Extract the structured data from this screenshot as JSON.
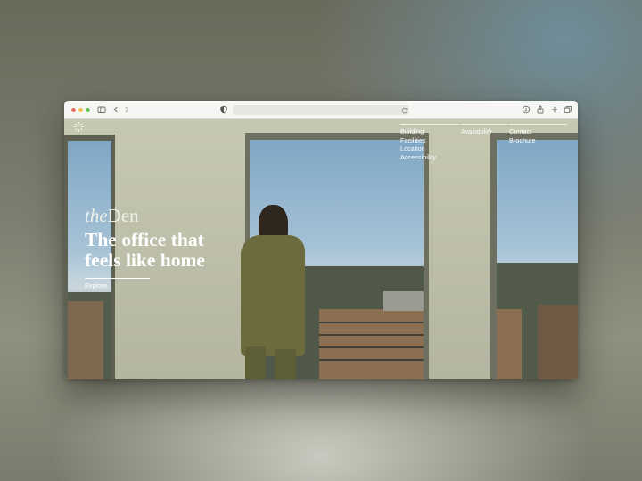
{
  "browser": {
    "buttons": {
      "close": "close",
      "minimize": "minimize",
      "zoom": "zoom"
    },
    "toolbar_icons": [
      "sidebar-icon",
      "chevron-left-icon",
      "chevron-right-icon",
      "shield-icon",
      "reload-icon",
      "download-icon",
      "share-icon",
      "plus-icon",
      "tabs-icon"
    ],
    "colors": {
      "close": "#ed6a5e",
      "minimize": "#f5bf4f",
      "zoom": "#62c554"
    }
  },
  "site": {
    "logo_icon": "sun-icon",
    "nav": {
      "col1": [
        "Building",
        "Facilities",
        "Location",
        "Accessibility"
      ],
      "col2": [
        "Availability"
      ],
      "col3": [
        "Contact",
        "Brochure"
      ]
    },
    "brand": {
      "prefix": "the",
      "name": "Den"
    },
    "hero": {
      "title": "The office that feels like home",
      "cta": "Explore"
    }
  }
}
